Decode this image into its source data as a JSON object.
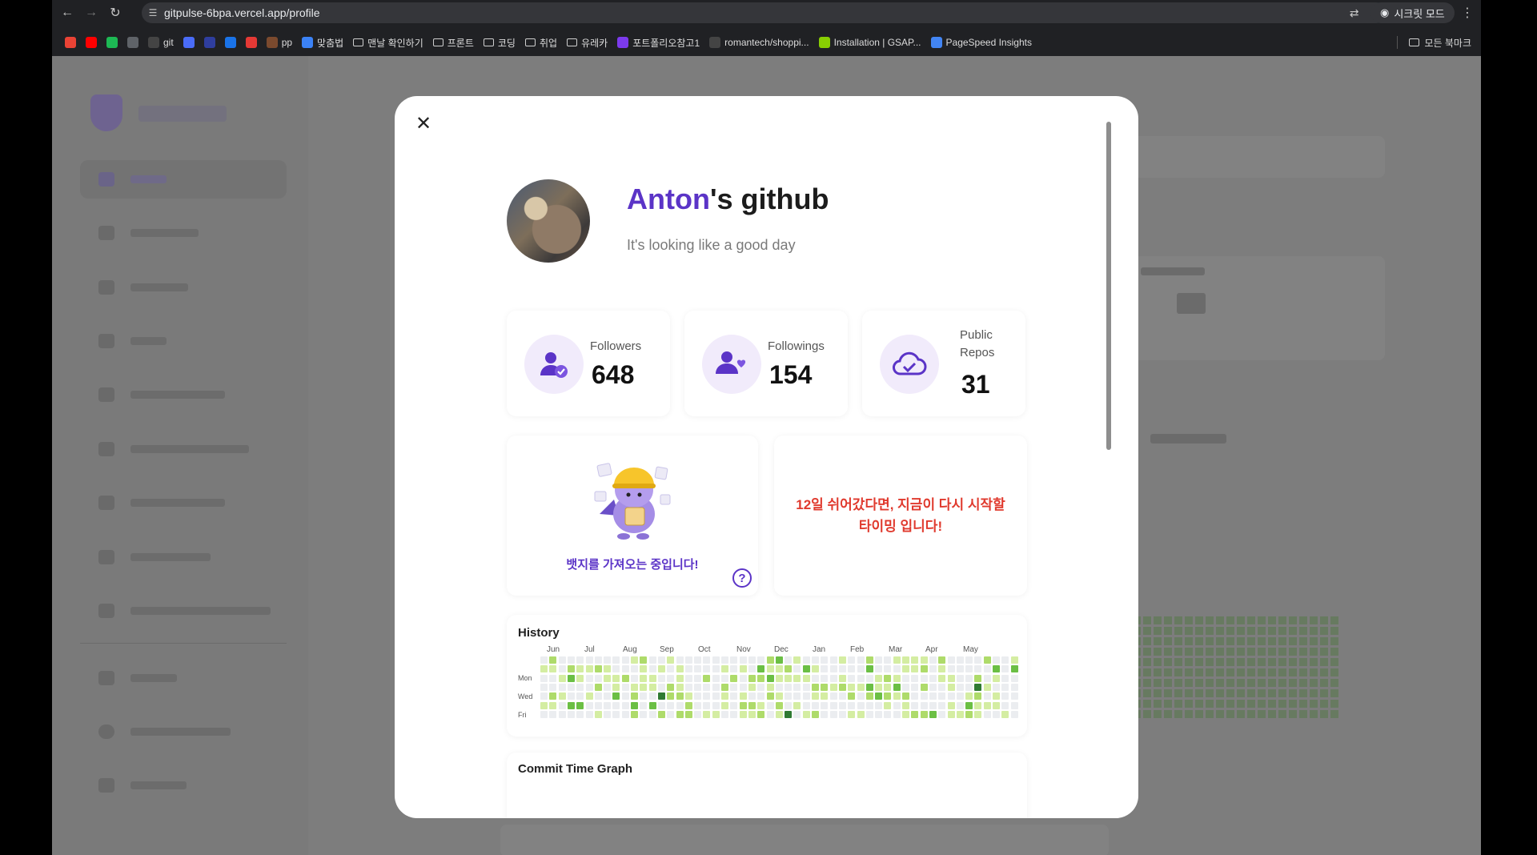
{
  "browser": {
    "url": "gitpulse-6bpa.vercel.app/profile",
    "incognito_label": "시크릿 모드",
    "bookmarks": [
      {
        "label": "",
        "icon": "gmail-icon",
        "color": "#ea4335"
      },
      {
        "label": "",
        "icon": "youtube-icon",
        "color": "#ff0000"
      },
      {
        "label": "",
        "icon": "green-icon",
        "color": "#1db954"
      },
      {
        "label": "",
        "icon": "app-icon",
        "color": "#5f6368"
      },
      {
        "label": "git",
        "icon": "github-icon",
        "color": "#444"
      },
      {
        "label": "",
        "icon": "code-icon",
        "color": "#4a6cf7"
      },
      {
        "label": "",
        "icon": "bird-icon",
        "color": "#2f3e9e"
      },
      {
        "label": "",
        "icon": "m-icon",
        "color": "#1a73e8"
      },
      {
        "label": "",
        "icon": "heart-icon",
        "color": "#e53935"
      },
      {
        "label": "pp",
        "icon": "avatar-icon",
        "color": "#7b4a2e"
      },
      {
        "label": "맞춤법",
        "icon": "bolt-icon",
        "color": "#3b82f6"
      },
      {
        "label": "맨날 확인하기",
        "icon": "folder-icon",
        "color": ""
      },
      {
        "label": "프론트",
        "icon": "folder-icon",
        "color": ""
      },
      {
        "label": "코딩",
        "icon": "folder-icon",
        "color": ""
      },
      {
        "label": "취업",
        "icon": "folder-icon",
        "color": ""
      },
      {
        "label": "유레카",
        "icon": "folder-icon",
        "color": ""
      },
      {
        "label": "포트폴리오참고1",
        "icon": "m-logo-icon",
        "color": "#7c3aed"
      },
      {
        "label": "romantech/shoppi...",
        "icon": "github-icon",
        "color": "#444"
      },
      {
        "label": "Installation | GSAP...",
        "icon": "gsap-icon",
        "color": "#88ce02"
      },
      {
        "label": "PageSpeed Insights",
        "icon": "pagespeed-icon",
        "color": "#4285f4"
      }
    ],
    "all_bookmarks_label": "모든 북마크"
  },
  "profile": {
    "name": "Anton",
    "title_suffix": "'s github",
    "subtitle": "It's looking like a good day"
  },
  "stats": [
    {
      "label": "Followers",
      "value": "648",
      "icon": "user-check-icon"
    },
    {
      "label": "Followings",
      "value": "154",
      "icon": "user-heart-icon"
    },
    {
      "label": "Public Repos",
      "value": "31",
      "icon": "cloud-check-icon"
    }
  ],
  "badge": {
    "loading_text": "뱃지를 가져오는 중입니다!",
    "help_label": "?"
  },
  "message": {
    "text": "12일 쉬어갔다면, 지금이 다시 시작할 타이밍 입니다!"
  },
  "history": {
    "title": "History",
    "months": [
      "Jun",
      "Jul",
      "Aug",
      "Sep",
      "Oct",
      "Nov",
      "Dec",
      "Jan",
      "Feb",
      "Mar",
      "Apr",
      "May"
    ],
    "days": [
      "Mon",
      "Wed",
      "Fri"
    ]
  },
  "commit_graph": {
    "title": "Commit Time Graph"
  },
  "colors": {
    "accent": "#5b34c7",
    "warning": "#e03a2e",
    "level0": "#ebedf0",
    "level1": "#d4eda2",
    "level2": "#aedb6a",
    "level3": "#6bbf44",
    "level4": "#2f7a32"
  }
}
